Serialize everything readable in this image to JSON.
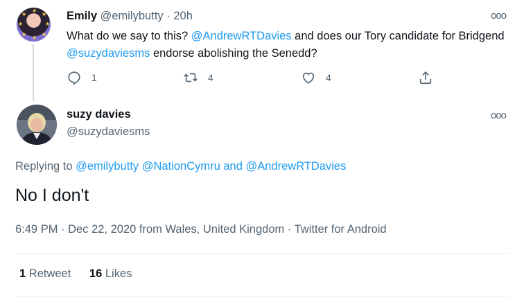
{
  "parent_tweet": {
    "author_name": "Emily",
    "author_handle": "@emilybutty",
    "separator": "·",
    "time_ago": "20h",
    "text_parts": {
      "a": "What do we say to this? ",
      "mention1": "@AndrewRTDavies",
      "b": " and does our Tory candidate for Bridgend ",
      "mention2": "@suzydaviesms",
      "c": " endorse abolishing the Senedd?"
    },
    "actions": {
      "reply_count": "1",
      "retweet_count": "4",
      "like_count": "4"
    },
    "icons": [
      "reply-icon",
      "retweet-icon",
      "like-icon",
      "share-icon",
      "more-icon"
    ]
  },
  "main_tweet": {
    "author_name": "suzy davies",
    "author_handle": "@suzydaviesms",
    "replying_prefix": "Replying to ",
    "replying_to": {
      "user1": "@emilybutty",
      "user2": "@NationCymru",
      "conjunction": " and ",
      "user3": "@AndrewRTDavies"
    },
    "text": "No I don't",
    "meta": {
      "time": "6:49 PM",
      "sep1": " · ",
      "date": "Dec 22, 2020",
      "location": " from Wales, United Kingdom",
      "sep2": " · ",
      "client": "Twitter for Android"
    },
    "stats": {
      "retweets_count": "1",
      "retweets_label": " Retweet",
      "likes_count": "16",
      "likes_label": " Likes"
    }
  },
  "colors": {
    "link": "#1d9bf0",
    "text": "#0f1419",
    "muted": "#536471",
    "divider": "#e6ecf0"
  }
}
